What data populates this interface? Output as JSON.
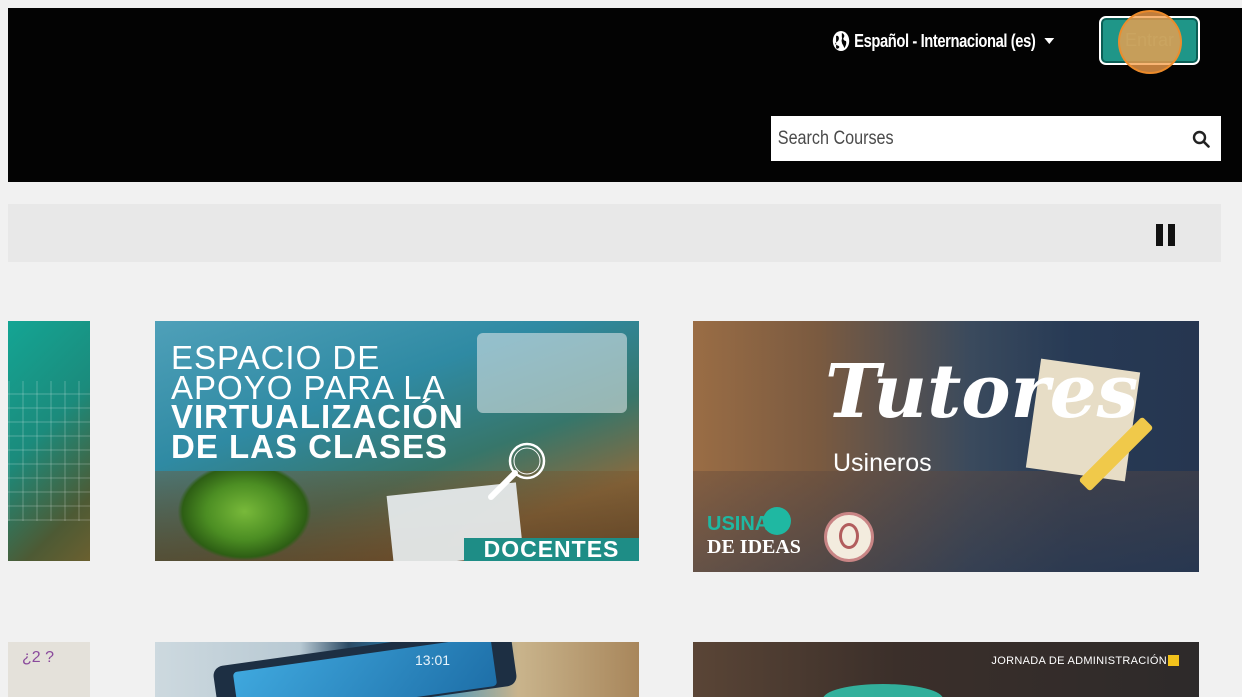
{
  "header": {
    "language_label": "Español - Internacional (es)",
    "login_label": "Entrar",
    "search": {
      "placeholder": "Search Courses"
    }
  },
  "carousel": {
    "pause_label": "Pause"
  },
  "courses": [
    {
      "title_lines": [
        "ESPACIO DE",
        "APOYO PARA LA",
        "VIRTUALIZACIÓN",
        "DE LAS CLASES"
      ],
      "ribbon": "DOCENTES"
    },
    {
      "title": "Tutores",
      "subtitle": "Usineros",
      "logo_top": "USINA",
      "logo_bottom": "DE IDEAS"
    },
    {
      "time": "13:01"
    },
    {
      "event_label": "JORNADA DE ADMINISTRACIÓN"
    }
  ],
  "colors": {
    "header_bg": "#030303",
    "page_bg": "#f1f1f1",
    "accent": "#1f9688",
    "ribbon": "#1e8d86"
  }
}
